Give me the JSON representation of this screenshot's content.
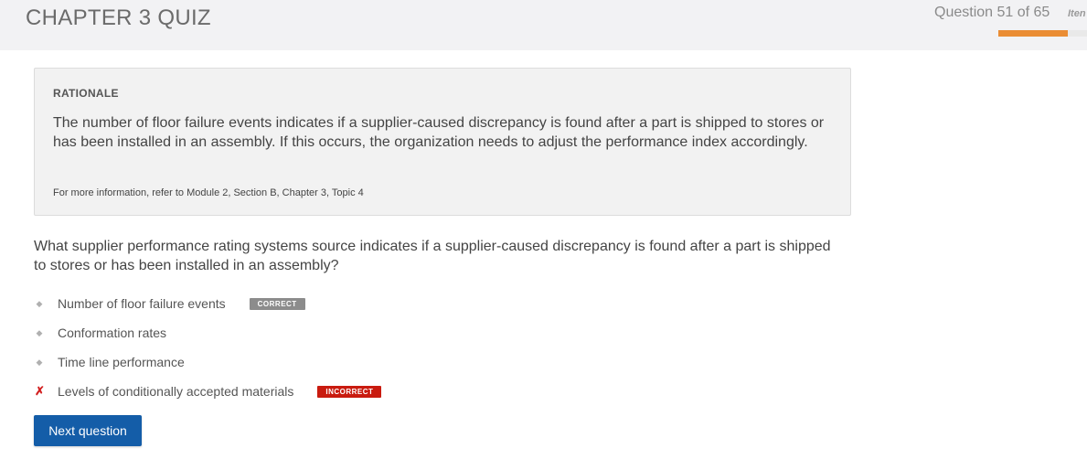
{
  "header": {
    "title": "CHAPTER 3 QUIZ",
    "progress_label": "Question 51 of 65",
    "items_link": "Iten",
    "progress_fraction": 0.78,
    "accent_color": "#ea8d34"
  },
  "rationale": {
    "heading": "RATIONALE",
    "body": "The number of floor failure events indicates if a supplier-caused discrepancy is found after a part is shipped to stores or has been installed in an assembly. If this occurs, the organization needs to adjust the performance index accordingly.",
    "reference": "For more information, refer to Module 2, Section B, Chapter 3, Topic 4"
  },
  "question": {
    "text": "What supplier performance rating systems source indicates if a supplier-caused discrepancy is found after a part is shipped to stores or has been installed in an assembly?",
    "options": [
      {
        "label": "Number of floor failure events",
        "marker": "◆",
        "badge": "CORRECT",
        "status": "correct"
      },
      {
        "label": "Conformation rates",
        "marker": "◆",
        "badge": "",
        "status": "none"
      },
      {
        "label": "Time line performance",
        "marker": "◆",
        "badge": "",
        "status": "none"
      },
      {
        "label": "Levels of conditionally accepted materials",
        "marker": "✗",
        "badge": "INCORRECT",
        "status": "incorrect"
      }
    ]
  },
  "footer": {
    "next_label": "Next question",
    "button_color": "#145da8"
  },
  "colors": {
    "correct_badge": "#8c8c8c",
    "incorrect_badge": "#c91b0f",
    "incorrect_marker": "#d21f1f"
  }
}
